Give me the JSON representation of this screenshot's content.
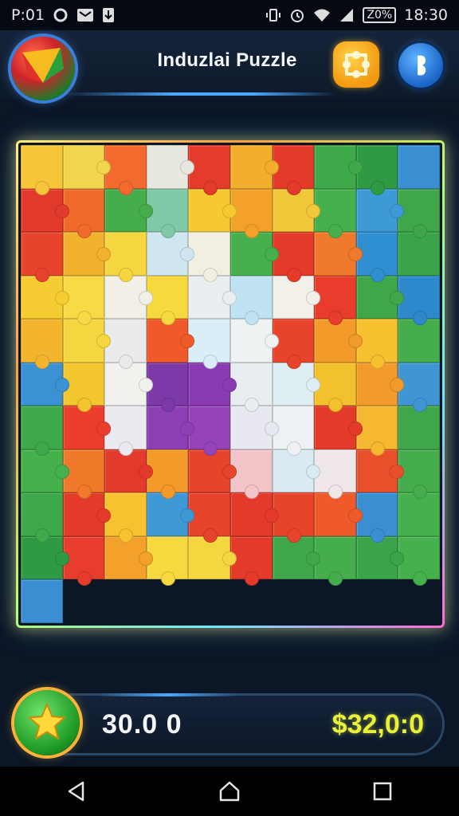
{
  "status_bar": {
    "left_text": "P:01",
    "time": "18:30",
    "battery": "Z0%"
  },
  "header": {
    "title": "Induzlai Puzzle"
  },
  "board": {
    "columns": 10,
    "rows": 11,
    "pieces": [
      "#f7c53a",
      "#f0d54e",
      "#f26a2e",
      "#e8e8e0",
      "#e43b2a",
      "#f2ae2c",
      "#e33a2a",
      "#3fa84a",
      "#2f9a44",
      "#3a8fd2",
      "#e23a2c",
      "#ef6a2b",
      "#46ad4c",
      "#7fc8a8",
      "#f5c92f",
      "#f3a12a",
      "#f0c83a",
      "#46b04e",
      "#3e9ad6",
      "#3fa64a",
      "#e8442c",
      "#f3b22e",
      "#f6d640",
      "#cfe6f0",
      "#f2efe2",
      "#46b04c",
      "#e43a2a",
      "#f07a2c",
      "#2f8fd0",
      "#3aa448",
      "#f5cc32",
      "#f7da46",
      "#f1efe6",
      "#f7d83e",
      "#e9eef0",
      "#bfe3f2",
      "#f3f0ea",
      "#e83c2c",
      "#3fa64a",
      "#2d88cc",
      "#f4b52e",
      "#f6d640",
      "#eaeaea",
      "#ee5a2a",
      "#d9eef6",
      "#eef2f2",
      "#e8442c",
      "#f29a2a",
      "#f6c02e",
      "#46ad4c",
      "#3a92d4",
      "#f3c52e",
      "#f1f1ee",
      "#7b3aa8",
      "#8a3ab2",
      "#e8eef0",
      "#dfeef2",
      "#f4c12e",
      "#f29a2c",
      "#3f96d2",
      "#3fa84a",
      "#ec3e2c",
      "#ede9f0",
      "#8d40b6",
      "#9444b8",
      "#e8e8f0",
      "#eef1f3",
      "#e43a2a",
      "#f5b830",
      "#3fa64a",
      "#46b04c",
      "#f07a2a",
      "#e33a2c",
      "#f39a2a",
      "#e8442c",
      "#f1c4c8",
      "#d9eaf2",
      "#f0e8e8",
      "#e8502c",
      "#46ad4c",
      "#3fa84a",
      "#e43a2a",
      "#f6c230",
      "#3e98d6",
      "#e8442c",
      "#e33a2c",
      "#e8442c",
      "#ee5a2a",
      "#3a8fd2",
      "#46b04c",
      "#2f9a44",
      "#e83c2c",
      "#f3a12a",
      "#f7d83e",
      "#f6d640",
      "#e33a2a",
      "#3fa64a",
      "#46ad4c",
      "#3aa448",
      "#46b04c",
      "#3a8fd2",
      "#2f9a44",
      "#3fa64a",
      "#46ad4c",
      "#f5c92f",
      "#e43b2a",
      "#3fa84a",
      "#e23a2c",
      "#e8442c",
      "#f2e2e6"
    ]
  },
  "bottom_bar": {
    "score": "30.0 0",
    "money": "$32,0:0"
  },
  "icons": {
    "logo": "app-logo-icon",
    "hint": "puzzle-hint-icon",
    "menu": "profile-icon",
    "star": "star-icon",
    "back": "back-icon",
    "home": "home-icon",
    "recents": "recents-icon"
  }
}
